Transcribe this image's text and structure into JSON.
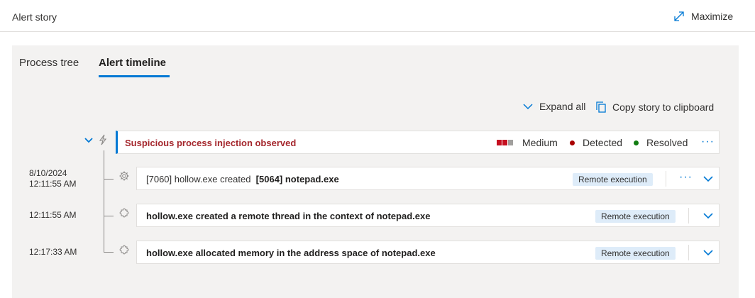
{
  "header": {
    "title": "Alert story",
    "maximize_label": "Maximize"
  },
  "tabs": [
    {
      "label": "Process tree",
      "active": false
    },
    {
      "label": "Alert timeline",
      "active": true
    }
  ],
  "toolbar": {
    "expand_all": "Expand all",
    "copy_story": "Copy story to clipboard"
  },
  "alert": {
    "title": "Suspicious process injection observed",
    "severity": "Medium",
    "severity_level": "2 of 3",
    "detection": "Detected",
    "status": "Resolved",
    "colors": {
      "title": "#a4262c",
      "accent": "#0078d4",
      "severity": "#c50f1f",
      "detected": "#a80000",
      "resolved": "#107c10"
    }
  },
  "events": [
    {
      "date": "8/10/2024",
      "time": "12:11:55 AM",
      "prefix": "[7060] hollow.exe created",
      "emphasis": "[5064] notepad.exe",
      "tag": "Remote execution",
      "icon": "gear-icon",
      "has_more": true
    },
    {
      "time": "12:11:55 AM",
      "text": "hollow.exe created a remote thread in the context of notepad.exe",
      "tag": "Remote execution",
      "icon": "puzzle-icon",
      "has_more": false
    },
    {
      "time": "12:17:33 AM",
      "text": "hollow.exe allocated memory in the address space of notepad.exe",
      "tag": "Remote execution",
      "icon": "puzzle-icon",
      "has_more": false
    }
  ],
  "more_glyph": "···"
}
